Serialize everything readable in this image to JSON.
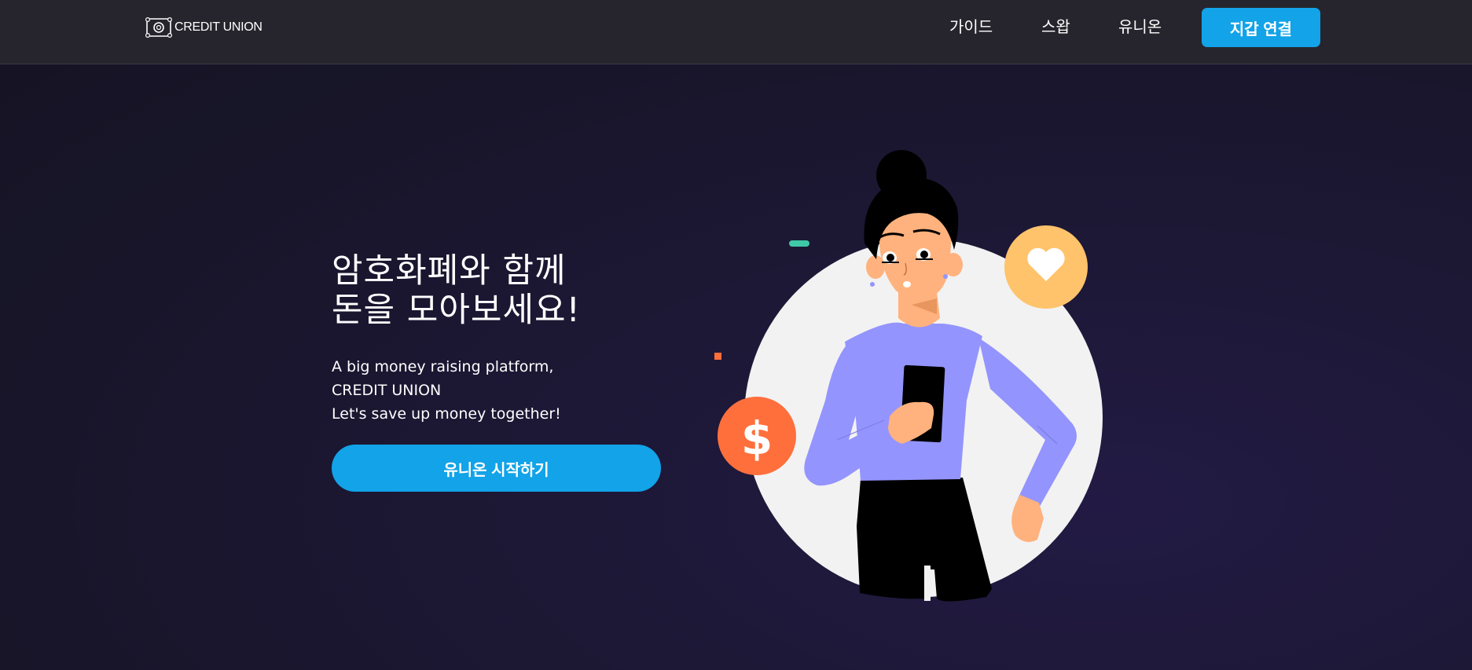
{
  "header": {
    "logo_text": "CREDIT UNION",
    "nav": [
      {
        "label": "가이드"
      },
      {
        "label": "스왑"
      },
      {
        "label": "유니온"
      }
    ],
    "connect_wallet_label": "지갑 연결"
  },
  "hero": {
    "title_line1": "암호화폐와 함께",
    "title_line2": "돈을 모아보세요!",
    "subtitle_line1": "A big money raising platform,",
    "subtitle_line2": "CREDIT UNION",
    "subtitle_line3": "Let's save up money together!",
    "cta_label": "유니온 시작하기"
  },
  "illustration": {
    "coin_symbol": "$",
    "icons": [
      "dollar-coin-icon",
      "heart-badge-icon",
      "smartphone-icon"
    ]
  },
  "colors": {
    "accent": "#12a3e8",
    "header_bg": "#26252d",
    "page_bg": "#1b1730",
    "coin_orange": "#ff6f3c",
    "heart_badge": "#ffc36b",
    "shirt_purple": "#9494ff"
  }
}
